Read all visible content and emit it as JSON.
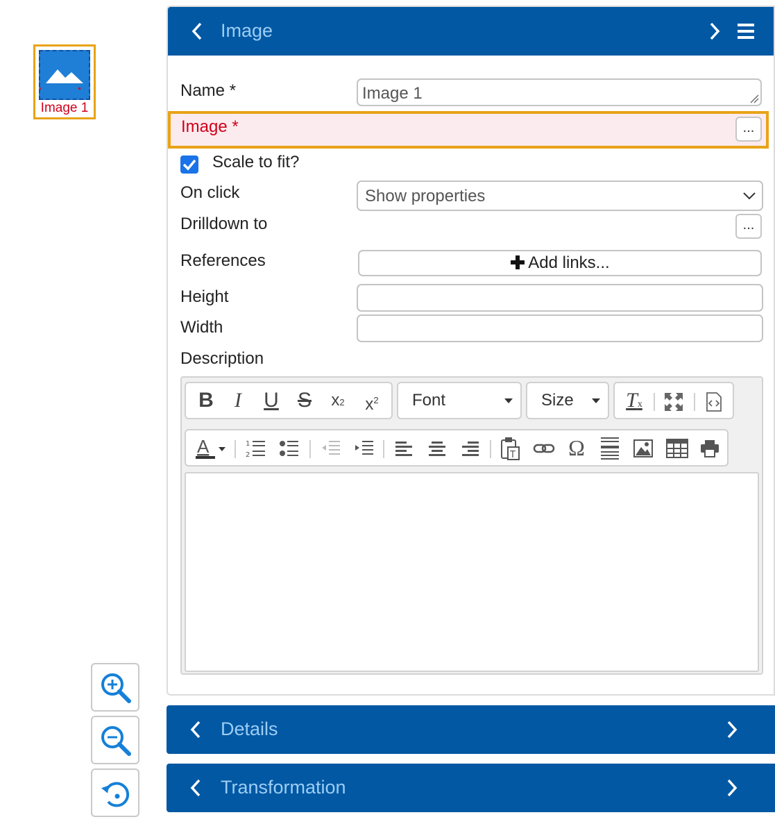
{
  "canvas": {
    "element_caption": "Image 1",
    "element_icon": "image-placeholder-icon"
  },
  "zoom": {
    "zoom_in": "zoom-in-icon",
    "zoom_out": "zoom-out-icon",
    "reset": "zoom-reset-icon"
  },
  "panel": {
    "title": "Image",
    "fields": {
      "name_label": "Name *",
      "name_value": "Image 1",
      "image_label": "Image *",
      "image_button": "...",
      "scale_label": "Scale to fit?",
      "scale_checked": true,
      "onclick_label": "On click",
      "onclick_value": "Show properties",
      "drilldown_label": "Drilldown to",
      "drilldown_button": "...",
      "references_label": "References",
      "add_links": "Add links...",
      "height_label": "Height",
      "height_value": "",
      "width_label": "Width",
      "width_value": "",
      "description_label": "Description"
    },
    "editor": {
      "font_label": "Font",
      "size_label": "Size",
      "content": ""
    }
  },
  "sections": {
    "details": "Details",
    "transformation": "Transformation"
  },
  "colors": {
    "header": "#0258a3",
    "header_text": "#9ccdf5",
    "error": "#d0001a",
    "highlight": "#e8a317"
  }
}
